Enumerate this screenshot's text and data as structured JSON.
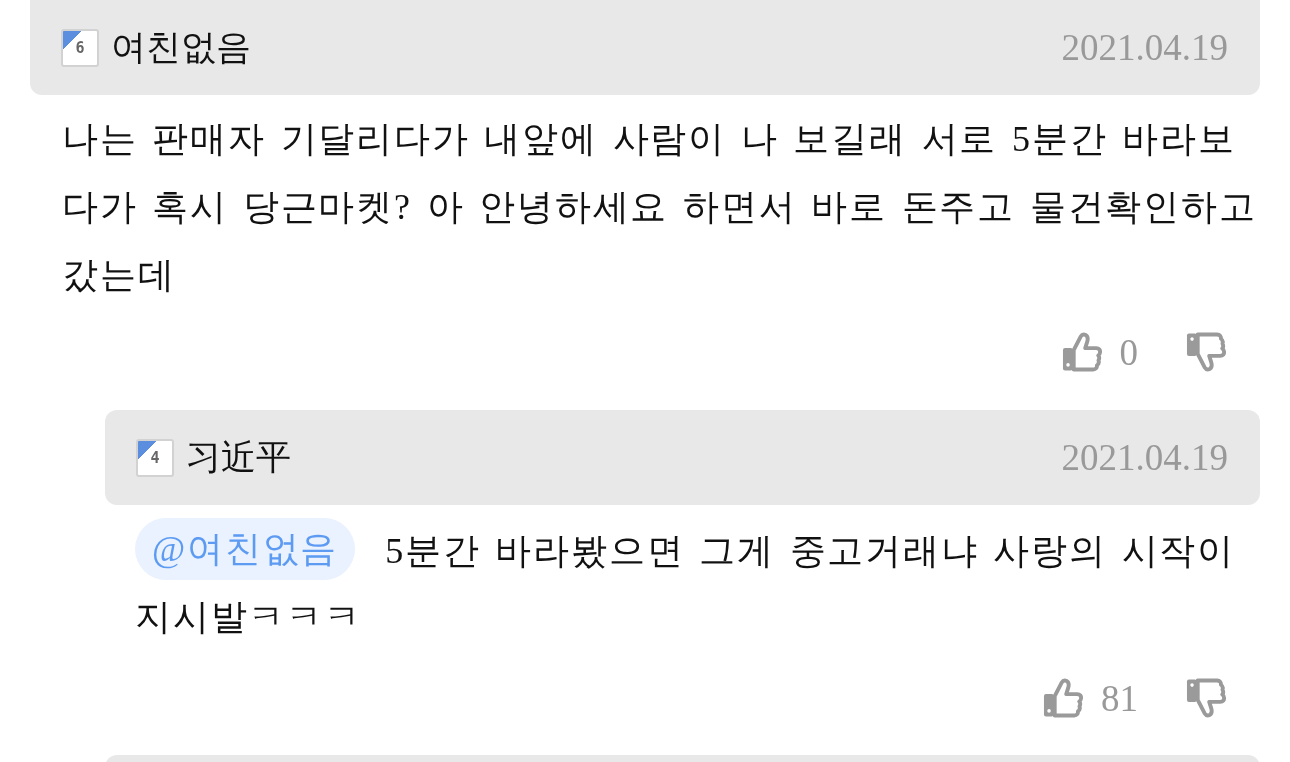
{
  "comment": {
    "author": {
      "level_badge": "6",
      "name": "여친없음"
    },
    "date": "2021.04.19",
    "text": "나는 판매자 기달리다가 내앞에 사람이 나 보길래 서로 5분간 바라보다가 혹시 당근마켓? 아 안녕하세요 하면서 바로 돈주고 물건확인하고 갔는데",
    "likes": "0",
    "replies": [
      {
        "author": {
          "level_badge": "4",
          "name": "习近平"
        },
        "date": "2021.04.19",
        "mention": "@여친없음",
        "text": "5분간 바라봤으면 그게 중고거래냐 사랑의 시작이 지시발ㅋㅋㅋ",
        "likes": "81"
      }
    ]
  }
}
